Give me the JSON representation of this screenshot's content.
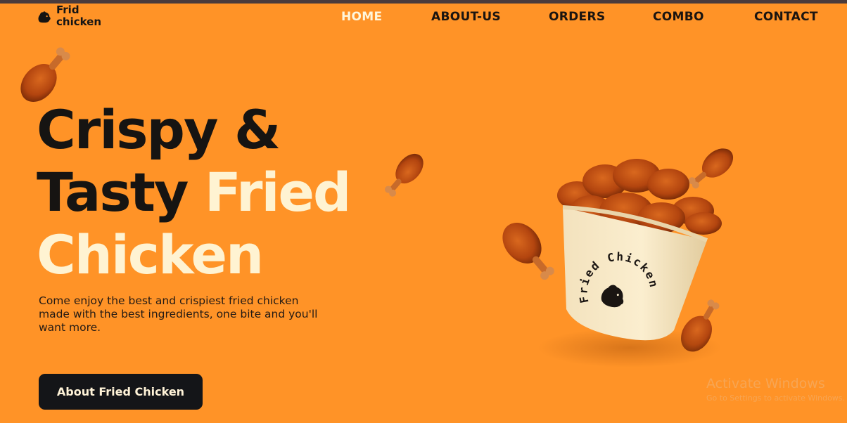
{
  "brand": {
    "name_line1": "Frid",
    "name_line2": "chicken"
  },
  "nav": {
    "items": [
      {
        "label": "HOME",
        "active": true
      },
      {
        "label": "ABOUT-US",
        "active": false
      },
      {
        "label": "ORDERS",
        "active": false
      },
      {
        "label": "COMBO",
        "active": false
      },
      {
        "label": "CONTACT",
        "active": false
      }
    ]
  },
  "hero": {
    "line1": "Crispy &",
    "line2_dark": "Tasty ",
    "line2_cream": "Fried",
    "line3": "Chicken",
    "description": "Come enjoy the best and crispiest fried chicken made with the best ingredients, one bite and you'll want more.",
    "cta_label": "About Fried Chicken",
    "bucket_label": "Fried Chicken"
  },
  "watermark": {
    "title": "Activate Windows",
    "subtitle": "Go to Settings to activate Windows."
  },
  "colors": {
    "background": "#ff9327",
    "dark": "#161412",
    "cream": "#fff3d2",
    "button": "#141518"
  }
}
